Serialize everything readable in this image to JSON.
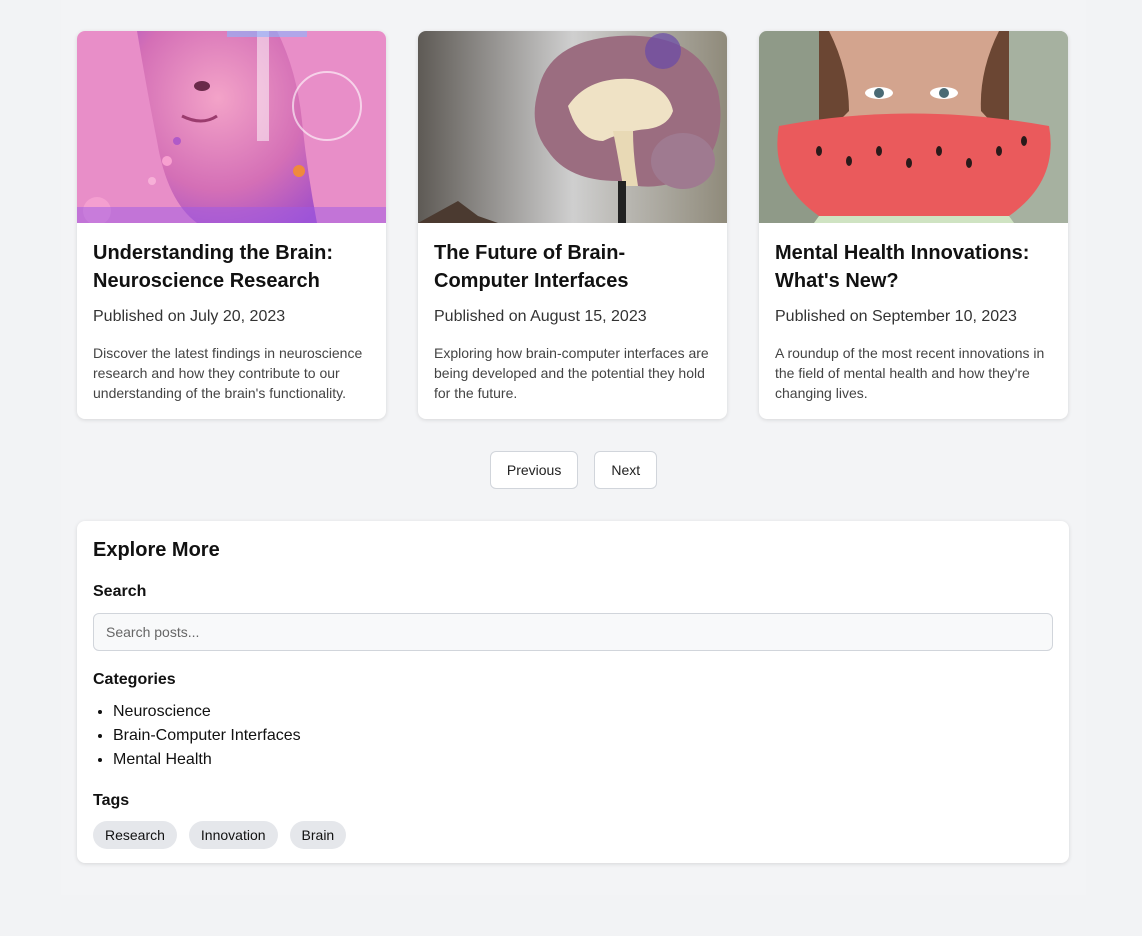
{
  "posts": [
    {
      "title": "Understanding the Brain: Neuroscience Research",
      "date": "Published on July 20, 2023",
      "description": "Discover the latest findings in neuroscience research and how they contribute to our understanding of the brain's functionality."
    },
    {
      "title": "The Future of Brain-Computer Interfaces",
      "date": "Published on August 15, 2023",
      "description": "Exploring how brain-computer interfaces are being developed and the potential they hold for the future."
    },
    {
      "title": "Mental Health Innovations: What's New?",
      "date": "Published on September 10, 2023",
      "description": "A roundup of the most recent innovations in the field of mental health and how they're changing lives."
    }
  ],
  "pagination": {
    "previous": "Previous",
    "next": "Next"
  },
  "sidebar": {
    "title": "Explore More",
    "search_label": "Search",
    "search_placeholder": "Search posts...",
    "categories_label": "Categories",
    "categories": [
      "Neuroscience",
      "Brain-Computer Interfaces",
      "Mental Health"
    ],
    "tags_label": "Tags",
    "tags": [
      "Research",
      "Innovation",
      "Brain"
    ]
  }
}
